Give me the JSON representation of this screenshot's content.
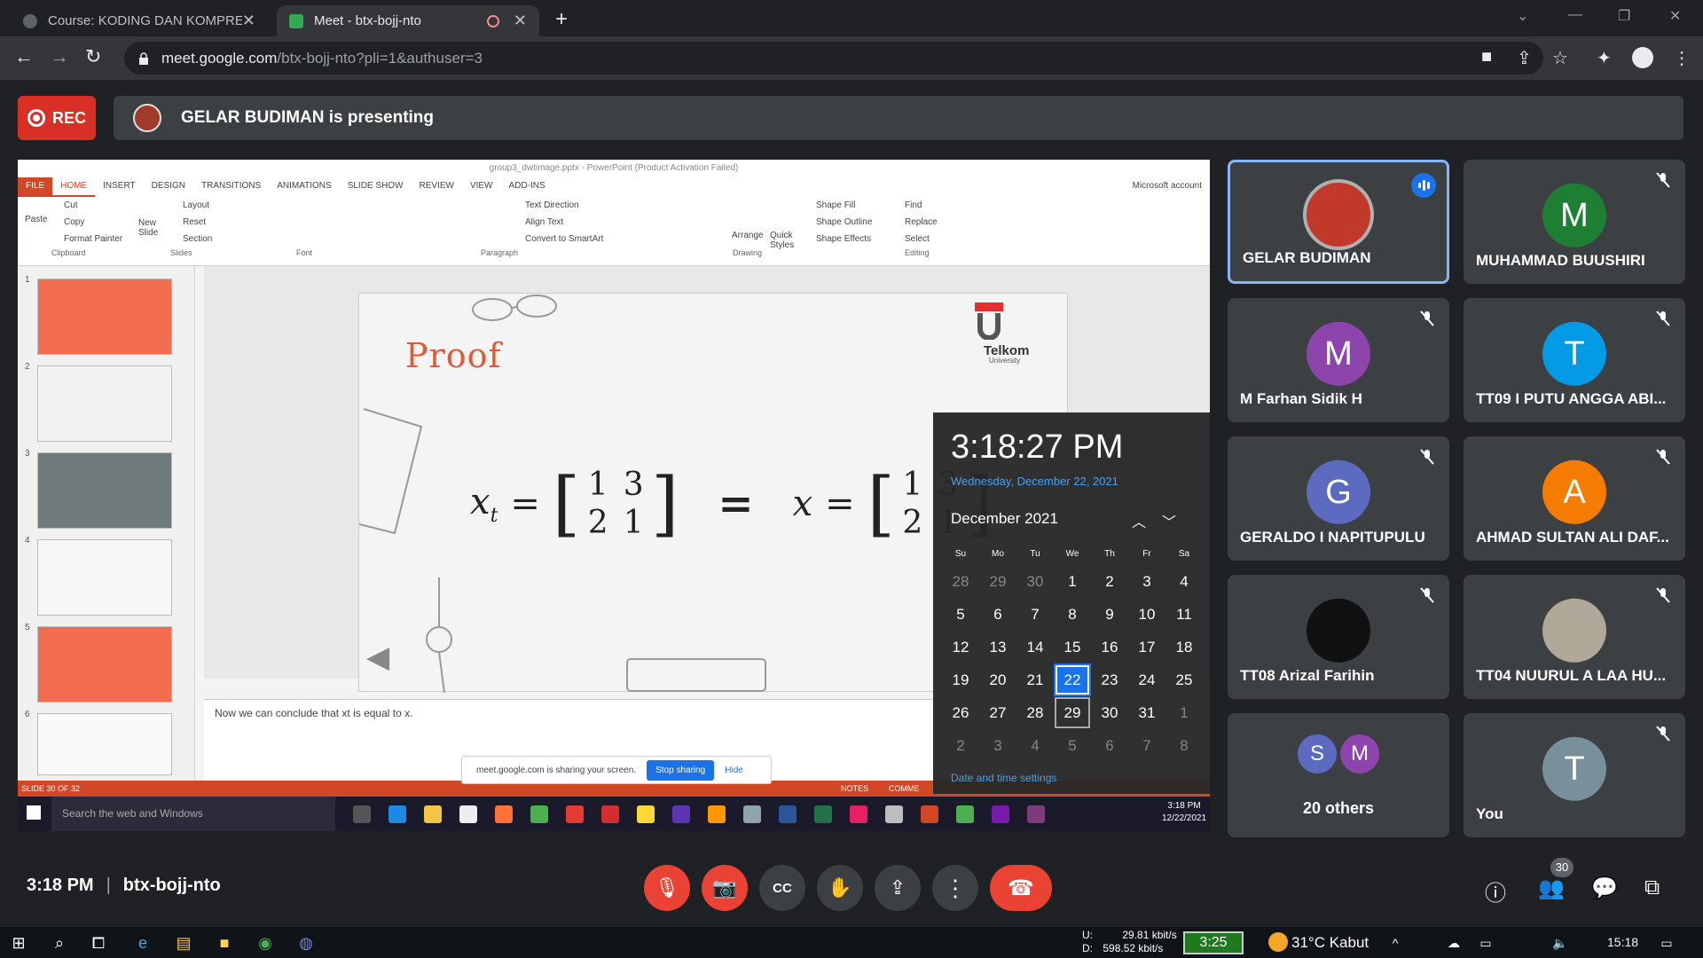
{
  "browser": {
    "tabs": [
      {
        "label": "Course: KODING DAN KOMPRESI"
      },
      {
        "label": "Meet - btx-bojj-nto"
      }
    ],
    "url_domain": "meet.google.com",
    "url_rest": "/btx-bojj-nto?pli=1&authuser=3"
  },
  "meet": {
    "rec_label": "REC",
    "presenting": "GELAR BUDIMAN is presenting",
    "time": "3:18 PM",
    "code": "btx-bojj-nto",
    "participants_count": "30",
    "tiles": [
      {
        "name": "GELAR BUDIMAN",
        "initial": "",
        "color": "#c0392b"
      },
      {
        "name": "MUHAMMAD BUUSHIRI",
        "initial": "M",
        "color": "#1e7e34"
      },
      {
        "name": "M Farhan Sidik H",
        "initial": "M",
        "color": "#8e44ad"
      },
      {
        "name": "TT09 I PUTU ANGGA ABI...",
        "initial": "T",
        "color": "#039be5"
      },
      {
        "name": "GERALDO I NAPITUPULU",
        "initial": "G",
        "color": "#5c6bc0"
      },
      {
        "name": "AHMAD SULTAN ALI DAF...",
        "initial": "A",
        "color": "#f57c00"
      },
      {
        "name": "TT08 Arizal Farihin",
        "initial": "",
        "color": "#111111"
      },
      {
        "name": "TT04 NUURUL A LAA HU...",
        "initial": "",
        "color": "#b0a898"
      },
      {
        "name": "20 others",
        "initial": "",
        "color": ""
      },
      {
        "name": "You",
        "initial": "T",
        "color": "#78909c"
      }
    ],
    "others_initials": [
      "S",
      "M"
    ]
  },
  "ppt": {
    "title": "group3_dwtimage.pptx - PowerPoint (Product Activation Failed)",
    "tabs": [
      "FILE",
      "HOME",
      "INSERT",
      "DESIGN",
      "TRANSITIONS",
      "ANIMATIONS",
      "SLIDE SHOW",
      "REVIEW",
      "VIEW",
      "ADD-INS"
    ],
    "account": "Microsoft account",
    "groups": [
      "Clipboard",
      "Slides",
      "Font",
      "Paragraph",
      "Drawing",
      "Editing"
    ],
    "buttons": {
      "cut": "Cut",
      "copy": "Copy",
      "format_painter": "Format Painter",
      "paste": "Paste",
      "new_slide": "New Slide",
      "layout": "Layout",
      "reset": "Reset",
      "section": "Section",
      "text_direction": "Text Direction",
      "align_text": "Align Text",
      "convert": "Convert to SmartArt",
      "arrange": "Arrange",
      "quick_styles": "Quick Styles",
      "shape_fill": "Shape Fill",
      "shape_outline": "Shape Outline",
      "shape_effects": "Shape Effects",
      "find": "Find",
      "replace": "Replace",
      "select": "Select"
    },
    "slide_numbers": [
      "1",
      "2",
      "3",
      "4",
      "5",
      "6"
    ],
    "slide_title": "Proof",
    "logo": "Telkom",
    "logo_sub": "University",
    "math": {
      "lhs": "x",
      "sub": "t",
      "eq": "=",
      "rhs": "x",
      "m": [
        "1",
        "3",
        "2",
        "1"
      ]
    },
    "notes": "Now we can conclude that xt is equal to x.",
    "status": "SLIDE 30 OF 32",
    "status_notes": "NOTES",
    "status_comments": "COMME",
    "search": "Search the web and Windows",
    "clock": "3:18 PM",
    "date": "12/22/2021",
    "share_msg": "meet.google.com is sharing your screen.",
    "stop_sharing": "Stop sharing",
    "hide": "Hide"
  },
  "calendar": {
    "time": "3:18:27 PM",
    "date": "Wednesday, December 22, 2021",
    "month": "December 2021",
    "days": [
      "Su",
      "Mo",
      "Tu",
      "We",
      "Th",
      "Fr",
      "Sa"
    ],
    "cells": [
      "28",
      "29",
      "30",
      "1",
      "2",
      "3",
      "4",
      "5",
      "6",
      "7",
      "8",
      "9",
      "10",
      "11",
      "12",
      "13",
      "14",
      "15",
      "16",
      "17",
      "18",
      "19",
      "20",
      "21",
      "22",
      "23",
      "24",
      "25",
      "26",
      "27",
      "28",
      "29",
      "30",
      "31",
      "1",
      "2",
      "3",
      "4",
      "5",
      "6",
      "7",
      "8"
    ],
    "settings": "Date and time settings"
  },
  "windows": {
    "upload": "29.81 kbit/s",
    "download": "598.52 kbit/s",
    "u": "U:",
    "d": "D:",
    "timer": "3:25",
    "weather": "31°C  Kabut",
    "time": "15:18"
  }
}
